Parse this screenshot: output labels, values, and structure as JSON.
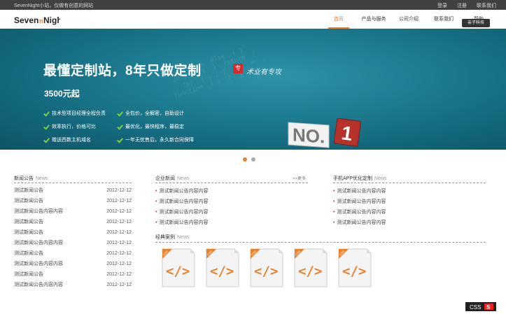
{
  "topbar": {
    "welcome": "SevenNight小站，仅做有创意的网站",
    "links": [
      "登录",
      "注册",
      "联系我们"
    ]
  },
  "logo": {
    "text_left": "Seven",
    "text_mid": "n",
    "text_right": "Night"
  },
  "nav": {
    "items": [
      "首页",
      "产品与服务",
      "公司介绍",
      "联系我们",
      "帮助"
    ],
    "active_index": 0,
    "badge": "亲子科技"
  },
  "banner": {
    "title": "最懂定制站，8年只做定制",
    "badge": "专",
    "slogan": "术业有专攻",
    "price": "3500元起",
    "features_left": [
      "技术型项目经理全程负责",
      "效率执行，价格可比",
      "赠送西数主机域名"
    ],
    "features_right": [
      "全包价，全解密，自助设计",
      "最优化，最快程序，最稳定",
      "一年无忧售后，永久新合同保障"
    ],
    "no1_text": "NO.",
    "no1_digit": "1",
    "slides": 2,
    "active_slide": 0
  },
  "col1": {
    "title": "新闻公告",
    "title_en": "News",
    "items": [
      {
        "title": "测试新闻公告",
        "date": "2012-12-12"
      },
      {
        "title": "测试新闻公告",
        "date": "2012-12-12"
      },
      {
        "title": "测试新闻公告内容内容",
        "date": "2012-12-12"
      },
      {
        "title": "测试新闻公告",
        "date": "2012-12-12"
      },
      {
        "title": "测试新闻公告",
        "date": "2012-12-12"
      },
      {
        "title": "测试新闻公告内容内容",
        "date": "2012-12-12"
      },
      {
        "title": "测试新闻公告",
        "date": "2012-12-12"
      },
      {
        "title": "测试新闻公告内容内容",
        "date": "2012-12-12"
      },
      {
        "title": "测试新闻公告",
        "date": "2012-12-12"
      },
      {
        "title": "测试新闻公告内容内容",
        "date": "2012-12-12"
      }
    ]
  },
  "col2": {
    "title": "企业新闻",
    "title_en": "News",
    "more": ">>更多",
    "items": [
      "测试新闻公告内容内容",
      "测试新闻公告内容内容",
      "测试新闻公告内容内容",
      "测试新闻公告内容内容"
    ]
  },
  "col3": {
    "title": "手机APP优化定制",
    "title_en": "News",
    "items": [
      "测试新闻公告内容内容",
      "测试新闻公告内容内容",
      "测试新闻公告内容内容",
      "测试新闻公告内容内容"
    ]
  },
  "cases": {
    "title": "经典案例",
    "title_en": "News",
    "count": 5,
    "tag": "CSS",
    "glyph": "</>"
  },
  "footer_badge": {
    "text": "CSS",
    "icon": "S"
  },
  "colors": {
    "accent": "#e8822d",
    "banner": "#1f7e93",
    "check": "#7cd13a"
  }
}
